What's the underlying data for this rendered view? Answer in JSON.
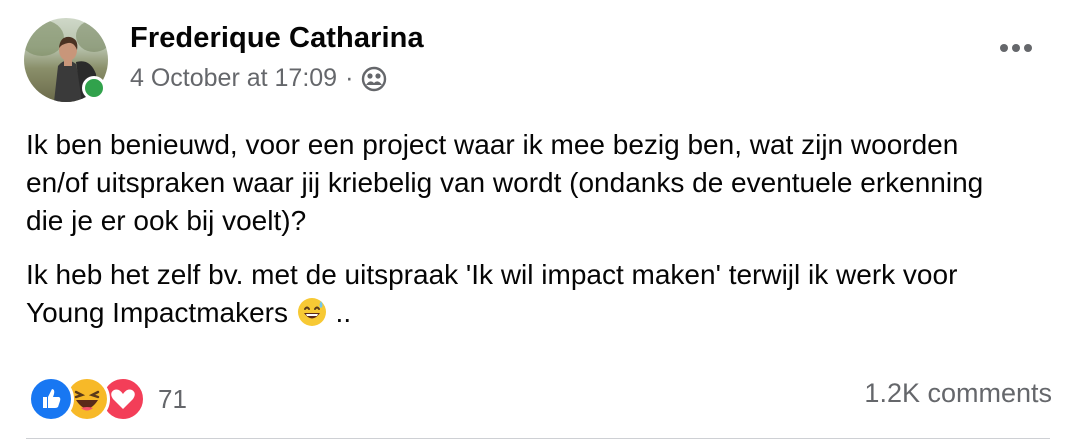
{
  "post": {
    "author": "Frederique Catharina",
    "timestamp": "4 October at 17:09",
    "separator": "·",
    "audience_icon": "friends-icon",
    "more_icon": "more-horizontal-icon",
    "paragraph1": "Ik ben benieuwd, voor een project waar ik mee bezig ben, wat zijn woorden en/of uitspraken waar jij kriebelig van wordt (ondanks de eventuele erkenning die je er ook bij voelt)?",
    "paragraph2_text": "Ik heb het zelf bv. met de uitspraak 'Ik wil impact maken' terwijl ik werk voor Young Impactmakers",
    "paragraph2_emoji": "sweat-smile-emoji",
    "paragraph2_suffix": " .."
  },
  "reactions": {
    "types": [
      "like",
      "haha",
      "love"
    ],
    "count": "71"
  },
  "comments": {
    "label": "1.2K comments"
  },
  "colors": {
    "online": "#31a24c",
    "secondary_text": "#65676b",
    "like": "#1877f2",
    "haha": "#f7b928",
    "love": "#f33e58"
  }
}
